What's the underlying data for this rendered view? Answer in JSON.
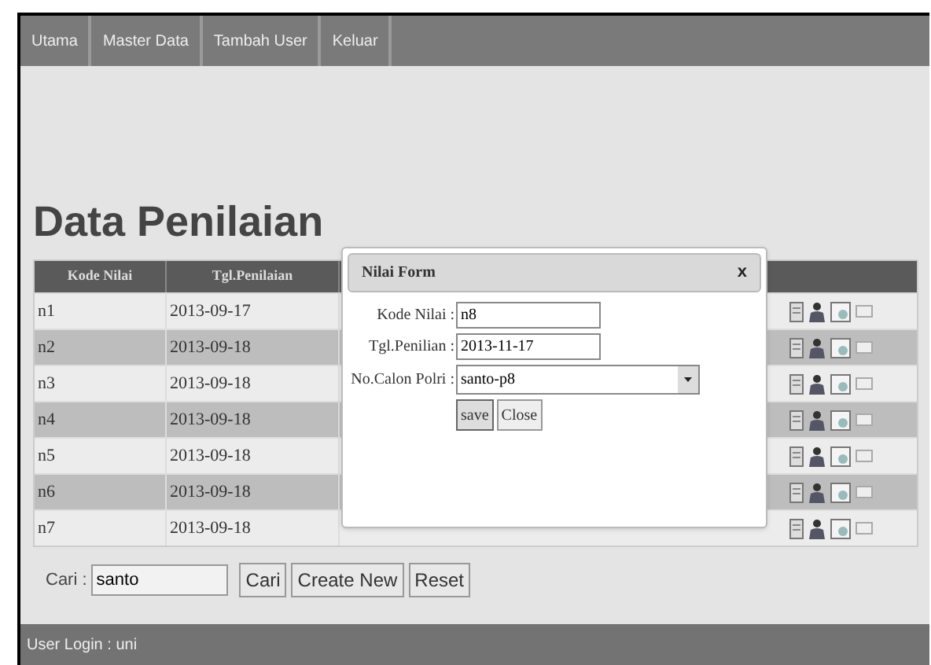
{
  "nav": {
    "items": [
      {
        "label": "Utama"
      },
      {
        "label": "Master Data"
      },
      {
        "label": "Tambah User"
      },
      {
        "label": "Keluar"
      }
    ]
  },
  "page_title": "Data Penilaian",
  "table": {
    "columns": [
      "Kode Nilai",
      "Tgl.Penilaian"
    ],
    "rows": [
      {
        "kode": "n1",
        "tgl": "2013-09-17"
      },
      {
        "kode": "n2",
        "tgl": "2013-09-18"
      },
      {
        "kode": "n3",
        "tgl": "2013-09-18"
      },
      {
        "kode": "n4",
        "tgl": "2013-09-18"
      },
      {
        "kode": "n5",
        "tgl": "2013-09-18"
      },
      {
        "kode": "n6",
        "tgl": "2013-09-18"
      },
      {
        "kode": "n7",
        "tgl": "2013-09-18"
      }
    ]
  },
  "search": {
    "label": "Cari :",
    "value": "santo",
    "buttons": [
      "Cari",
      "Create New",
      "Reset"
    ]
  },
  "dialog": {
    "title": "Nilai Form",
    "close": "x",
    "fields": [
      {
        "kind": "input",
        "label": "Kode Nilai :",
        "value": "n8"
      },
      {
        "kind": "input",
        "label": "Tgl.Penilian :",
        "value": "2013-11-17"
      },
      {
        "kind": "select",
        "label": "No.Calon Polri :",
        "value": "santo-p8"
      }
    ],
    "buttons": [
      "save",
      "Close"
    ]
  },
  "footer": "User Login : uni"
}
